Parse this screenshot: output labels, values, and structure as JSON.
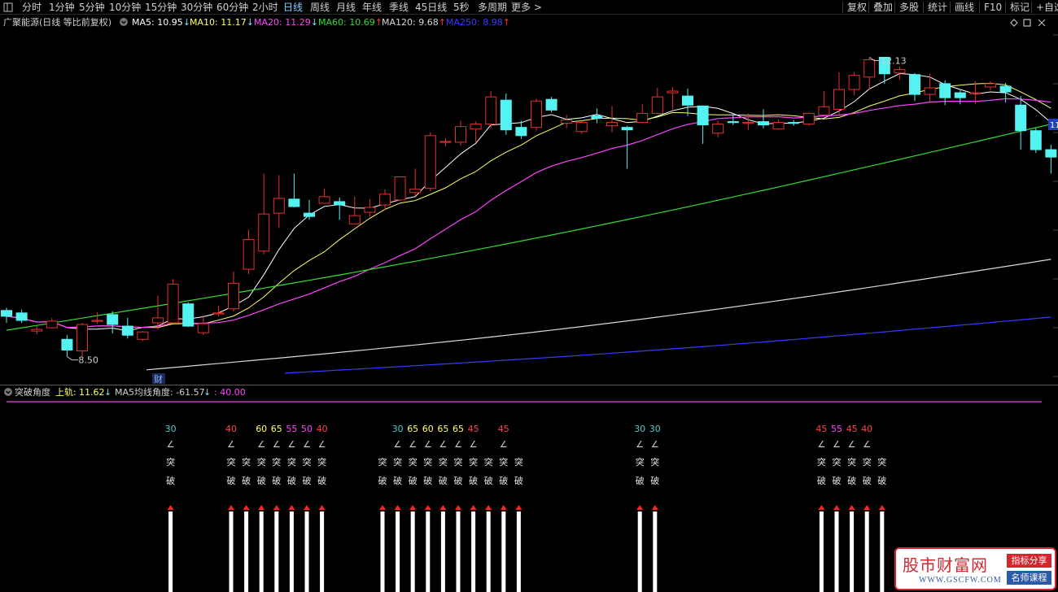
{
  "toolbar": {
    "left_items": [
      "分时",
      "1分钟",
      "5分钟",
      "10分钟",
      "15分钟",
      "30分钟",
      "60分钟",
      "2小时",
      "日线",
      "周线",
      "月线",
      "年线",
      "季线",
      "45日线",
      "5秒",
      "多周期",
      "更多 >"
    ],
    "active_index": 8,
    "right_items": [
      "复权",
      "叠加",
      "多股",
      "统计",
      "画线",
      "F10",
      "标记",
      "+自选"
    ]
  },
  "main_header": {
    "title": "广聚能源(日线 等比前复权)",
    "ma": [
      {
        "label": "MA5: 10.95",
        "arrow": "↓",
        "color": "#ffffff"
      },
      {
        "label": "MA10: 11.17",
        "arrow": "↓",
        "color": "#ffff66"
      },
      {
        "label": "MA20: 11.29",
        "arrow": "↓",
        "color": "#ff44ff"
      },
      {
        "label": "MA60: 10.69",
        "arrow": "↑",
        "color": "#33dd33"
      },
      {
        "label": "MA120: 9.68",
        "arrow": "↑",
        "color": "#d8d8d8"
      },
      {
        "label": "MA250: 8.98",
        "arrow": "↑",
        "color": "#3a3aff"
      }
    ]
  },
  "indicator_header": {
    "title": "突破角度",
    "upper_label": "上轨: ",
    "upper_value": "11.62",
    "upper_arrow": "↓",
    "ma5_label": "MA5均线角度: -61.57",
    "ma5_arrow": "↓",
    "threshold_label": ": 40.00"
  },
  "chart_data": {
    "type": "candlestick",
    "annotations": {
      "high_label": "12.13",
      "low_label": "8.50",
      "event_marker": "财",
      "right_edge_label": "11"
    },
    "candles": [
      {
        "o": 9.06,
        "h": 9.09,
        "l": 8.91,
        "c": 8.99
      },
      {
        "o": 9.03,
        "h": 9.07,
        "l": 8.91,
        "c": 8.94
      },
      {
        "o": 8.81,
        "h": 8.87,
        "l": 8.77,
        "c": 8.83
      },
      {
        "o": 8.85,
        "h": 8.97,
        "l": 8.84,
        "c": 8.93
      },
      {
        "o": 8.71,
        "h": 8.76,
        "l": 8.5,
        "c": 8.58
      },
      {
        "o": 8.57,
        "h": 8.91,
        "l": 8.5,
        "c": 8.89
      },
      {
        "o": 8.93,
        "h": 9.04,
        "l": 8.9,
        "c": 8.94
      },
      {
        "o": 9.01,
        "h": 9.05,
        "l": 8.78,
        "c": 8.89
      },
      {
        "o": 8.87,
        "h": 8.97,
        "l": 8.72,
        "c": 8.76
      },
      {
        "o": 8.71,
        "h": 8.81,
        "l": 8.69,
        "c": 8.8
      },
      {
        "o": 8.91,
        "h": 9.24,
        "l": 8.83,
        "c": 8.97
      },
      {
        "o": 8.91,
        "h": 9.44,
        "l": 8.9,
        "c": 9.38
      },
      {
        "o": 9.14,
        "h": 9.16,
        "l": 8.86,
        "c": 8.87
      },
      {
        "o": 8.79,
        "h": 9.0,
        "l": 8.76,
        "c": 8.9
      },
      {
        "o": 9.03,
        "h": 9.12,
        "l": 8.99,
        "c": 9.03
      },
      {
        "o": 9.08,
        "h": 9.53,
        "l": 9.05,
        "c": 9.39
      },
      {
        "o": 9.56,
        "h": 10.04,
        "l": 9.5,
        "c": 9.92
      },
      {
        "o": 9.78,
        "h": 10.72,
        "l": 9.74,
        "c": 10.23
      },
      {
        "o": 10.24,
        "h": 10.7,
        "l": 10.06,
        "c": 10.42
      },
      {
        "o": 10.41,
        "h": 10.72,
        "l": 10.31,
        "c": 10.32
      },
      {
        "o": 10.24,
        "h": 10.4,
        "l": 10.16,
        "c": 10.2
      },
      {
        "o": 10.36,
        "h": 10.54,
        "l": 10.36,
        "c": 10.44
      },
      {
        "o": 10.38,
        "h": 10.43,
        "l": 10.16,
        "c": 10.34
      },
      {
        "o": 10.11,
        "h": 10.44,
        "l": 10.11,
        "c": 10.21
      },
      {
        "o": 10.25,
        "h": 10.41,
        "l": 10.2,
        "c": 10.31
      },
      {
        "o": 10.34,
        "h": 10.53,
        "l": 10.28,
        "c": 10.47
      },
      {
        "o": 10.4,
        "h": 10.53,
        "l": 10.39,
        "c": 10.68
      },
      {
        "o": 10.49,
        "h": 10.78,
        "l": 10.45,
        "c": 10.53
      },
      {
        "o": 10.54,
        "h": 11.22,
        "l": 10.51,
        "c": 11.18
      },
      {
        "o": 11.1,
        "h": 11.15,
        "l": 11.05,
        "c": 11.11
      },
      {
        "o": 11.1,
        "h": 11.36,
        "l": 11.06,
        "c": 11.29
      },
      {
        "o": 11.26,
        "h": 11.35,
        "l": 11.1,
        "c": 11.32
      },
      {
        "o": 11.32,
        "h": 11.72,
        "l": 11.27,
        "c": 11.65
      },
      {
        "o": 11.61,
        "h": 11.69,
        "l": 11.19,
        "c": 11.25
      },
      {
        "o": 11.28,
        "h": 11.36,
        "l": 11.14,
        "c": 11.18
      },
      {
        "o": 11.28,
        "h": 11.63,
        "l": 11.24,
        "c": 11.6
      },
      {
        "o": 11.62,
        "h": 11.65,
        "l": 11.46,
        "c": 11.49
      },
      {
        "o": 11.33,
        "h": 11.43,
        "l": 11.27,
        "c": 11.37
      },
      {
        "o": 11.23,
        "h": 11.36,
        "l": 11.2,
        "c": 11.34
      },
      {
        "o": 11.42,
        "h": 11.51,
        "l": 11.33,
        "c": 11.39
      },
      {
        "o": 11.3,
        "h": 11.54,
        "l": 11.22,
        "c": 11.34
      },
      {
        "o": 11.28,
        "h": 11.3,
        "l": 10.78,
        "c": 11.25
      },
      {
        "o": 11.34,
        "h": 11.56,
        "l": 11.33,
        "c": 11.45
      },
      {
        "o": 11.45,
        "h": 11.76,
        "l": 11.44,
        "c": 11.65
      },
      {
        "o": 11.7,
        "h": 11.77,
        "l": 11.5,
        "c": 11.72
      },
      {
        "o": 11.66,
        "h": 11.75,
        "l": 11.42,
        "c": 11.55
      },
      {
        "o": 11.54,
        "h": 11.51,
        "l": 11.08,
        "c": 11.31
      },
      {
        "o": 11.21,
        "h": 11.36,
        "l": 11.16,
        "c": 11.32
      },
      {
        "o": 11.35,
        "h": 11.44,
        "l": 11.31,
        "c": 11.34
      },
      {
        "o": 11.34,
        "h": 11.45,
        "l": 11.25,
        "c": 11.34
      },
      {
        "o": 11.35,
        "h": 11.5,
        "l": 11.27,
        "c": 11.31
      },
      {
        "o": 11.26,
        "h": 11.37,
        "l": 11.25,
        "c": 11.34
      },
      {
        "o": 11.34,
        "h": 11.37,
        "l": 11.3,
        "c": 11.33
      },
      {
        "o": 11.32,
        "h": 11.46,
        "l": 11.3,
        "c": 11.45
      },
      {
        "o": 11.43,
        "h": 11.72,
        "l": 11.42,
        "c": 11.53
      },
      {
        "o": 11.5,
        "h": 11.95,
        "l": 11.43,
        "c": 11.74
      },
      {
        "o": 11.74,
        "h": 11.95,
        "l": 11.67,
        "c": 11.91
      },
      {
        "o": 11.89,
        "h": 12.13,
        "l": 11.74,
        "c": 12.1
      },
      {
        "o": 12.13,
        "h": 12.05,
        "l": 11.81,
        "c": 11.93
      },
      {
        "o": 11.94,
        "h": 12.02,
        "l": 11.86,
        "c": 11.98
      },
      {
        "o": 11.92,
        "h": 11.94,
        "l": 11.6,
        "c": 11.68
      },
      {
        "o": 11.68,
        "h": 11.93,
        "l": 11.59,
        "c": 11.76
      },
      {
        "o": 11.81,
        "h": 11.85,
        "l": 11.55,
        "c": 11.64
      },
      {
        "o": 11.7,
        "h": 11.73,
        "l": 11.56,
        "c": 11.64
      },
      {
        "o": 11.7,
        "h": 11.84,
        "l": 11.56,
        "c": 11.7
      },
      {
        "o": 11.77,
        "h": 11.84,
        "l": 11.73,
        "c": 11.81
      },
      {
        "o": 11.78,
        "h": 11.82,
        "l": 11.58,
        "c": 11.71
      },
      {
        "o": 11.55,
        "h": 11.66,
        "l": 11.01,
        "c": 11.24
      },
      {
        "o": 11.24,
        "h": 11.27,
        "l": 10.97,
        "c": 11.01
      },
      {
        "o": 11.01,
        "h": 11.07,
        "l": 10.72,
        "c": 10.92
      }
    ]
  },
  "indicator": {
    "columns": [
      {
        "label": "30",
        "color": "#55cccc",
        "show_text": true
      },
      null,
      null,
      null,
      {
        "label": "40",
        "color": "#ff4444",
        "show_text": true
      },
      {
        "label": "",
        "color": "",
        "show_text": true
      },
      {
        "label": "60",
        "color": "#ffff66",
        "show_text": true
      },
      {
        "label": "65",
        "color": "#ffff66",
        "show_text": true
      },
      {
        "label": "55",
        "color": "#ff44ff",
        "show_text": true
      },
      {
        "label": "50",
        "color": "#ff44ff",
        "show_text": true
      },
      {
        "label": "40",
        "color": "#ff4444",
        "show_text": true
      },
      null,
      null,
      null,
      {
        "label": "",
        "color": "",
        "show_text": true
      },
      {
        "label": "30",
        "color": "#55cccc",
        "show_text": true
      },
      {
        "label": "65",
        "color": "#ffff66",
        "show_text": true
      },
      {
        "label": "60",
        "color": "#ffff66",
        "show_text": true
      },
      {
        "label": "65",
        "color": "#ffff66",
        "show_text": true
      },
      {
        "label": "65",
        "color": "#ffff66",
        "show_text": true
      },
      {
        "label": "45",
        "color": "#ff4444",
        "show_text": true
      },
      {
        "label": "",
        "color": "",
        "show_text": true
      },
      {
        "label": "45",
        "color": "#ff4444",
        "show_text": true
      },
      {
        "label": "",
        "color": "",
        "show_text": true
      },
      null,
      null,
      null,
      null,
      null,
      null,
      null,
      {
        "label": "30",
        "color": "#55cccc",
        "show_text": true
      },
      {
        "label": "30",
        "color": "#55cccc",
        "show_text": true
      },
      null,
      null,
      null,
      null,
      null,
      null,
      null,
      null,
      null,
      null,
      {
        "label": "45",
        "color": "#ff4444",
        "show_text": true
      },
      {
        "label": "55",
        "color": "#ff44ff",
        "show_text": true
      },
      {
        "label": "45",
        "color": "#ff4444",
        "show_text": true
      },
      {
        "label": "40",
        "color": "#ff4444",
        "show_text": true
      },
      {
        "label": "",
        "color": "",
        "show_text": true
      }
    ],
    "angle_symbol": "∠",
    "text_top": "突",
    "text_bottom": "破"
  },
  "watermark": {
    "title": "股市财富网",
    "url": "WWW.GSCFW.COM",
    "tag1": "指标分享",
    "tag2": "名师课程"
  }
}
